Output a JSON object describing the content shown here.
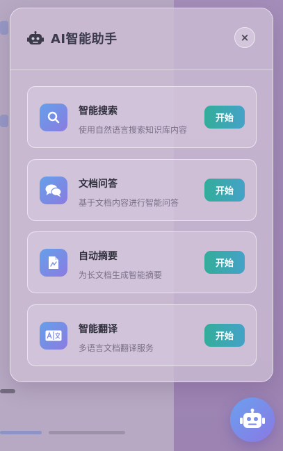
{
  "assistant": {
    "title": "AI智能助手",
    "header_icon": "robot-icon",
    "close_label": "×"
  },
  "features": [
    {
      "title": "智能搜索",
      "description": "使用自然语言搜索知识库内容",
      "icon": "search-icon",
      "button_label": "开始"
    },
    {
      "title": "文档问答",
      "description": "基于文档内容进行智能问答",
      "icon": "chat-bubbles-icon",
      "button_label": "开始"
    },
    {
      "title": "自动摘要",
      "description": "为长文档生成智能摘要",
      "icon": "document-icon",
      "button_label": "开始"
    },
    {
      "title": "智能翻译",
      "description": "多语言文档翻译服务",
      "icon": "translate-icon",
      "button_label": "开始"
    }
  ],
  "colors": {
    "button_gradient_start": "#33ad9a",
    "button_gradient_end": "#45a2c8",
    "icon_gradient_start": "#64a0ea",
    "icon_gradient_end": "#8b7be0"
  },
  "fab": {
    "icon": "robot-icon"
  }
}
